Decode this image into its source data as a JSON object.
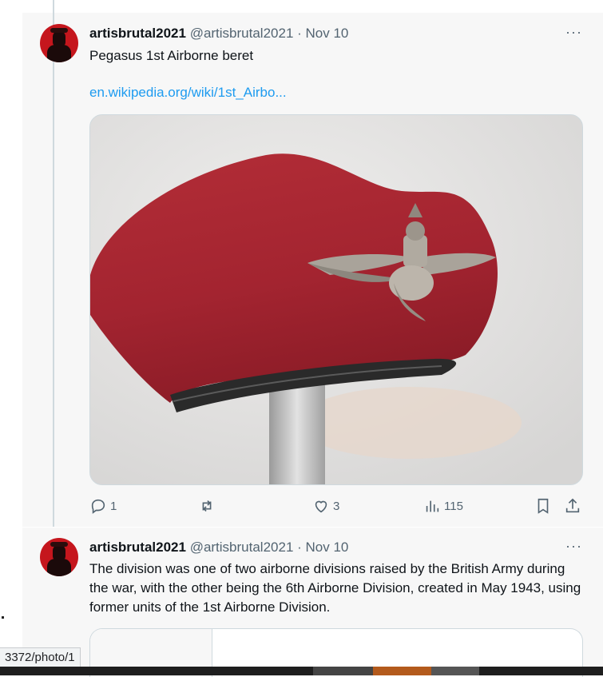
{
  "tweets": [
    {
      "name": "artisbrutal2021",
      "handle": "@artisbrutal2021 · Nov 10",
      "text": "Pegasus 1st Airborne beret",
      "link": "en.wikipedia.org/wiki/1st_Airbo...",
      "more": "···",
      "actions": {
        "reply": "1",
        "retweet": "",
        "like": "3",
        "views": "115"
      }
    },
    {
      "name": "artisbrutal2021",
      "handle": "@artisbrutal2021 · Nov 10",
      "more": "···",
      "text": "The division was one of two airborne divisions raised by the British Army during the war, with the other being the 6th Airborne Division, created in May 1943, using former units of the 1st Airborne Division."
    }
  ],
  "status_bar": {
    "url": "3372/photo/1"
  },
  "colors": {
    "accent": "#1d9bf0",
    "beret": "#a8282f",
    "muted": "#536471"
  },
  "icons": [
    "reply-icon",
    "retweet-icon",
    "like-icon",
    "views-icon",
    "bookmark-icon",
    "share-icon",
    "more-icon"
  ]
}
